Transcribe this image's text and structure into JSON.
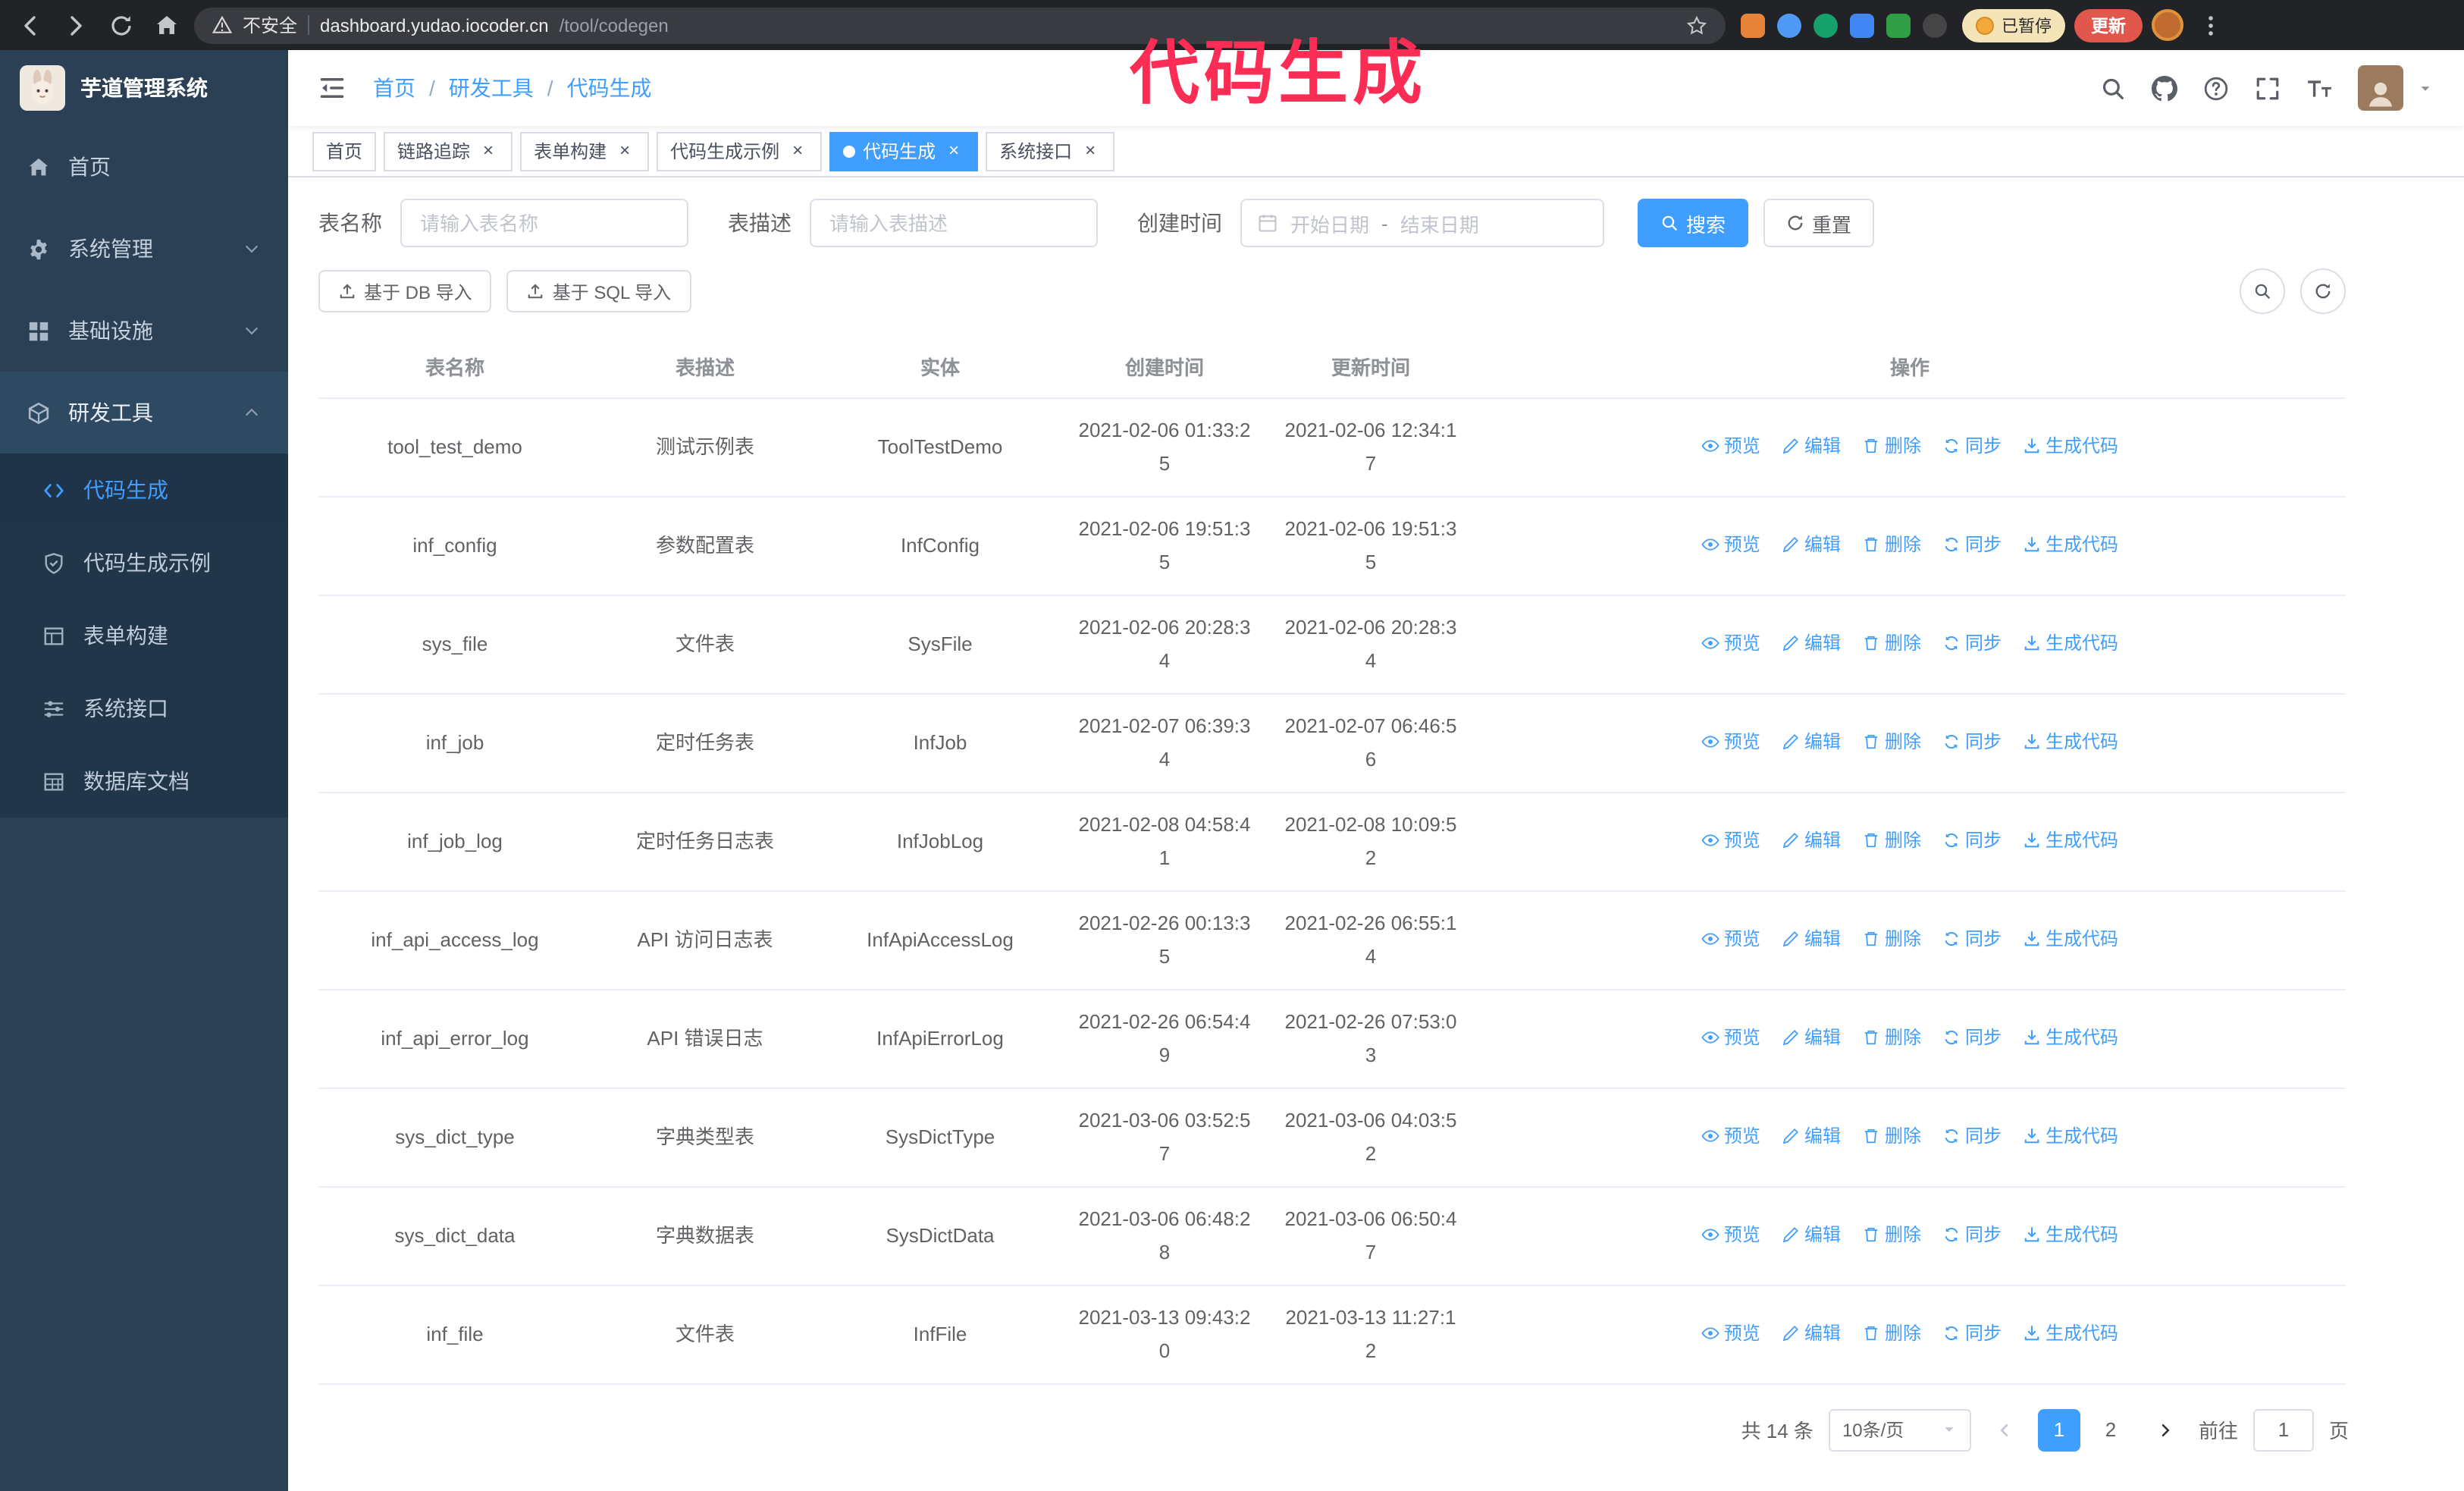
{
  "colors": {
    "accent": "#409eff",
    "annotation": "#fb2d55",
    "update_button": "#e2574c",
    "sidebar_bg": "#2b4054",
    "active_tab_bg": "#409eff"
  },
  "annotation": {
    "text": "代码生成",
    "color": "#fb2d55"
  },
  "browser": {
    "security_label": "不安全",
    "url_host": "dashboard.yudao.iocoder.cn",
    "url_path": "/tool/codegen",
    "paused_badge": "已暂停",
    "update_button": "更新"
  },
  "sidebar": {
    "app_title": "芋道管理系统",
    "items": [
      {
        "label": "首页",
        "icon": "home"
      },
      {
        "label": "系统管理",
        "icon": "gear",
        "chevron": "down"
      },
      {
        "label": "基础设施",
        "icon": "grid",
        "chevron": "down"
      },
      {
        "label": "研发工具",
        "icon": "tools",
        "chevron": "up",
        "expanded": true
      }
    ],
    "submenu": [
      {
        "label": "代码生成",
        "icon": "code",
        "active": true
      },
      {
        "label": "代码生成示例",
        "icon": "shield"
      },
      {
        "label": "表单构建",
        "icon": "form"
      },
      {
        "label": "系统接口",
        "icon": "sliders"
      },
      {
        "label": "数据库文档",
        "icon": "db"
      }
    ]
  },
  "header": {
    "breadcrumb": [
      "首页",
      "研发工具",
      "代码生成"
    ]
  },
  "tabs": [
    {
      "label": "首页",
      "closable": false
    },
    {
      "label": "链路追踪",
      "closable": true
    },
    {
      "label": "表单构建",
      "closable": true
    },
    {
      "label": "代码生成示例",
      "closable": true
    },
    {
      "label": "代码生成",
      "closable": true,
      "active": true
    },
    {
      "label": "系统接口",
      "closable": true
    }
  ],
  "filters": {
    "table_name_label": "表名称",
    "table_name_placeholder": "请输入表名称",
    "table_desc_label": "表描述",
    "table_desc_placeholder": "请输入表描述",
    "create_time_label": "创建时间",
    "date_start_placeholder": "开始日期",
    "date_separator": "-",
    "date_end_placeholder": "结束日期",
    "search_button": "搜索",
    "reset_button": "重置"
  },
  "toolbar": {
    "import_db_button": "基于 DB 导入",
    "import_sql_button": "基于 SQL 导入"
  },
  "table": {
    "columns": [
      "表名称",
      "表描述",
      "实体",
      "创建时间",
      "更新时间",
      "操作"
    ],
    "actions": [
      "预览",
      "编辑",
      "删除",
      "同步",
      "生成代码"
    ],
    "rows": [
      {
        "name": "tool_test_demo",
        "desc": "测试示例表",
        "entity": "ToolTestDemo",
        "created": "2021-02-06 01:33:25",
        "updated": "2021-02-06 12:34:17"
      },
      {
        "name": "inf_config",
        "desc": "参数配置表",
        "entity": "InfConfig",
        "created": "2021-02-06 19:51:35",
        "updated": "2021-02-06 19:51:35"
      },
      {
        "name": "sys_file",
        "desc": "文件表",
        "entity": "SysFile",
        "created": "2021-02-06 20:28:34",
        "updated": "2021-02-06 20:28:34"
      },
      {
        "name": "inf_job",
        "desc": "定时任务表",
        "entity": "InfJob",
        "created": "2021-02-07 06:39:34",
        "updated": "2021-02-07 06:46:56"
      },
      {
        "name": "inf_job_log",
        "desc": "定时任务日志表",
        "entity": "InfJobLog",
        "created": "2021-02-08 04:58:41",
        "updated": "2021-02-08 10:09:52"
      },
      {
        "name": "inf_api_access_log",
        "desc": "API 访问日志表",
        "entity": "InfApiAccessLog",
        "created": "2021-02-26 00:13:35",
        "updated": "2021-02-26 06:55:14"
      },
      {
        "name": "inf_api_error_log",
        "desc": "API 错误日志",
        "entity": "InfApiErrorLog",
        "created": "2021-02-26 06:54:49",
        "updated": "2021-02-26 07:53:03"
      },
      {
        "name": "sys_dict_type",
        "desc": "字典类型表",
        "entity": "SysDictType",
        "created": "2021-03-06 03:52:57",
        "updated": "2021-03-06 04:03:52"
      },
      {
        "name": "sys_dict_data",
        "desc": "字典数据表",
        "entity": "SysDictData",
        "created": "2021-03-06 06:48:28",
        "updated": "2021-03-06 06:50:47"
      },
      {
        "name": "inf_file",
        "desc": "文件表",
        "entity": "InfFile",
        "created": "2021-03-13 09:43:20",
        "updated": "2021-03-13 11:27:12"
      }
    ]
  },
  "pagination": {
    "total": "共 14 条",
    "page_size": "10条/页",
    "pages": [
      "1",
      "2"
    ],
    "active_page": "1",
    "goto_label": "前往",
    "goto_value": "1",
    "page_suffix": "页"
  }
}
